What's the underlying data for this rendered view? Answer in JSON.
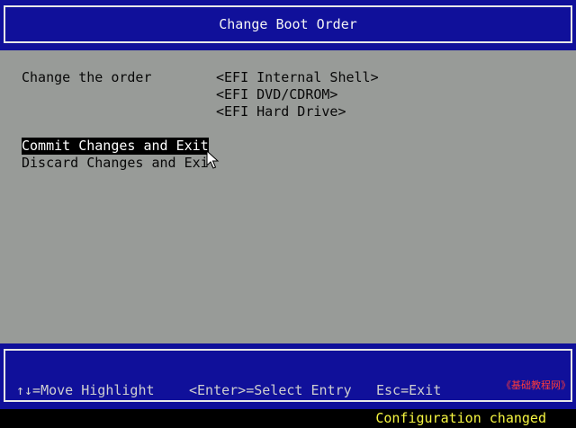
{
  "header": {
    "title": "Change Boot Order"
  },
  "main": {
    "order_label": "Change the order",
    "boot_order": [
      "<EFI Internal Shell>",
      "<EFI DVD/CDROM>",
      "<EFI Hard Drive>"
    ],
    "actions": [
      {
        "label": "Commit Changes and Exit",
        "selected": true
      },
      {
        "label": "Discard Changes and Exit",
        "selected": false
      }
    ]
  },
  "help": {
    "move": "↑↓=Move Highlight",
    "select": "<Enter>=Select Entry",
    "exit": "Esc=Exit",
    "watermark": "《基础教程网》"
  },
  "status": {
    "message": "Configuration changed"
  },
  "colors": {
    "band_blue": "#10109a",
    "panel_gray": "#989b98",
    "status_yellow": "#f6f640",
    "watermark_red": "#ff3a3a"
  },
  "icons": {
    "cursor": "mouse-pointer-icon"
  }
}
